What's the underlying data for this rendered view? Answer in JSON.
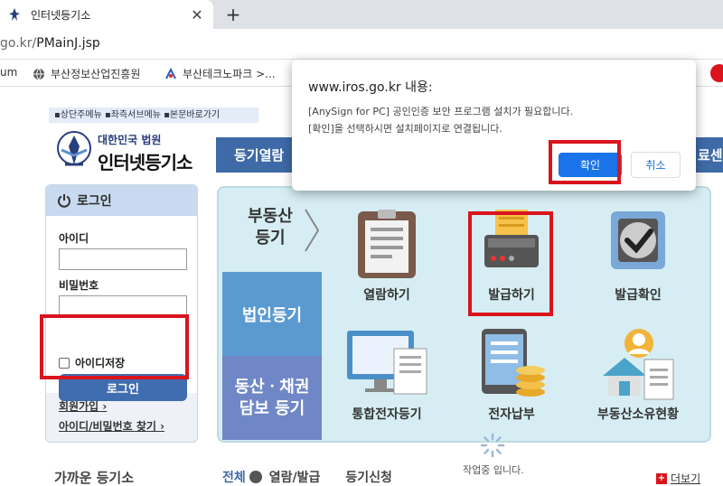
{
  "browser": {
    "tab_title": "인터넷등기소",
    "close_symbol": "✕",
    "newtab_symbol": "+",
    "address_prefix": "go.kr/",
    "address_path": "PMainJ.jsp",
    "bookmarks": [
      "um",
      "부산정보산업진흥원",
      "부산테크노파크 >..."
    ]
  },
  "page": {
    "skip_links": "▪상단주메뉴 ▪좌측서브메뉴 ▪본문바로가기",
    "logo_sub": "대한민국 법원",
    "logo_main": "인터넷등기소",
    "nav_first": "등기열람",
    "nav_last": "료센"
  },
  "login": {
    "header": "로그인",
    "id_label": "아이디",
    "pw_label": "비밀번호",
    "save_id_label": "아이디저장",
    "login_button": "로그인",
    "signup": "회원가입 ›",
    "find": "아이디/비밀번호 찾기 ›"
  },
  "services": {
    "side_realestate": "부동산\n등기",
    "side_realestate_l1": "부동산",
    "side_realestate_l2": "등기",
    "side_corporate": "법인등기",
    "side_collateral_l1": "동산ㆍ채권",
    "side_collateral_l2": "담보 등기",
    "items": [
      {
        "label": "열람하기"
      },
      {
        "label": "발급하기"
      },
      {
        "label": "발급확인"
      },
      {
        "label": "통합전자등기"
      },
      {
        "label": "전자납부"
      },
      {
        "label": "부동산소유현황"
      }
    ]
  },
  "bottom": {
    "nearby": "가까운 등기소",
    "tab_all": "전체",
    "tab_view": "열람/발급",
    "tab_apply": "등기신청",
    "loading": "작업중 입니다.",
    "more": "더보기"
  },
  "dialog": {
    "title": "www.iros.go.kr 내용:",
    "line1": "[AnySign for PC] 공인인증 보안 프로그램 설치가 필요합니다.",
    "line2": "[확인]을 선택하시면 설치페이지로 연결됩니다.",
    "ok": "확인",
    "cancel": "취소"
  },
  "colors": {
    "accent_blue": "#3e6aa7",
    "highlight_red": "#d9141c",
    "chrome_button": "#1a73e8"
  }
}
